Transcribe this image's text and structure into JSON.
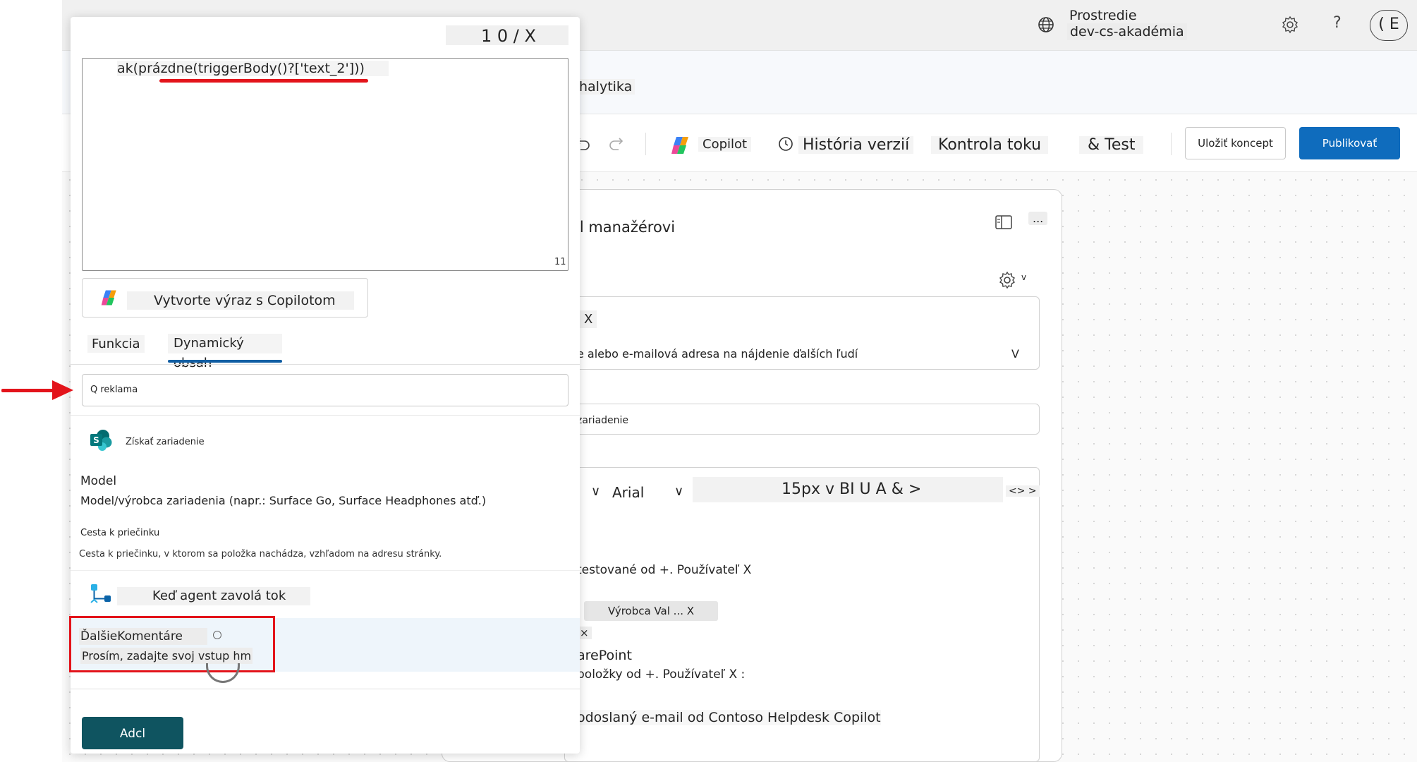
{
  "header": {
    "env_label": "Prostredie",
    "env_name": "dev-cs-akadémia",
    "help": "?",
    "avatar_initial": "( E"
  },
  "subbar": {
    "title": "halytika"
  },
  "toolbar": {
    "copilot": "Copilot",
    "history": "História verzií",
    "flow_check": "Kontrola toku",
    "test": "& Test",
    "save_draft": "Uložiť koncept",
    "publish": "Publikovať"
  },
  "card": {
    "title": "il manažérovi",
    "more": "...",
    "gear_chevron": "v",
    "to_value": "X",
    "to_help": "e alebo e-mailová adresa na nájdenie ďalších ľudí",
    "to_chevron": "V",
    "subject_value": "zariadenie",
    "rte_sep": "l",
    "rte_chevron": "∨",
    "rte_font": "Arial",
    "rte_tools": "15px v BI U A & >",
    "rte_code": "<> >",
    "line1": "testované od +. Používateľ X",
    "pill": "Výrobca Val ... X",
    "pill_x": "×",
    "line_sp": "arePoint",
    "line2": "položky od +. Používateľ X :",
    "line3": "odoslaný e-mail od Contoso Helpdesk Copilot"
  },
  "panel": {
    "counter": "1 0 / X",
    "expression": "ak(prázdne(triggerBody()?['text_2']))",
    "char_count": "11",
    "copilot_button": "Vytvorte výraz s Copilotom",
    "tab_function": "Funkcia",
    "tab_dynamic": "Dynamický obsah",
    "search_value": "Q reklama",
    "sp_group": "Získať zariadenie",
    "model_title": "Model",
    "model_desc": "Model/výrobca zariadenia (napr.: Surface Go, Surface Headphones atď.)",
    "path_title": "Cesta k priečinku",
    "path_desc": "Cesta k priečinku, v ktorom sa položka nachádza, vzhľadom na adresu stránky.",
    "flow_group": "Keď agent zavolá tok",
    "comment_title": "ĎalšieKomentáre",
    "comment_desc": "Prosím, zadajte svoj vstup hm",
    "add_button": "Adcl"
  },
  "colors": {
    "accent": "#0f6cbd",
    "add_button": "#0f5460",
    "annotation_red": "#e3141b",
    "tab_underline": "#115ea3"
  },
  "icons": [
    "globe-icon",
    "gear-icon",
    "undo-icon",
    "redo-icon",
    "copilot-icon",
    "history-icon",
    "side-panel-icon",
    "sharepoint-icon",
    "flow-trigger-icon"
  ]
}
